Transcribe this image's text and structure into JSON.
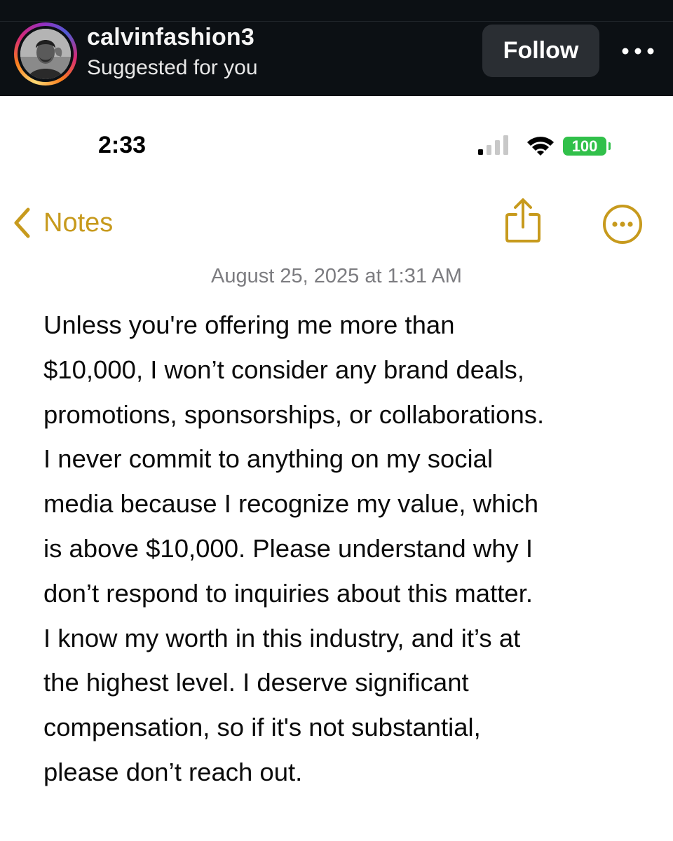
{
  "post_header": {
    "username": "calvinfashion3",
    "subtitle": "Suggested for you",
    "follow_label": "Follow",
    "more_icon": "ellipsis-icon"
  },
  "status_bar": {
    "time": "2:33",
    "battery": "100"
  },
  "nav": {
    "back_label": "Notes"
  },
  "note": {
    "date": "August 25, 2025 at 1:31 AM",
    "lines": [
      "Unless you're offering me more than",
      "$10,000, I won’t consider any brand deals,",
      "promotions, sponsorships, or collaborations.",
      "I never commit to anything on my social",
      "media because I recognize my value, which",
      "is above $10,000. Please understand why I",
      "don’t respond to inquiries about this matter.",
      "I know my worth in this industry, and it’s at",
      "the highest level. I deserve significant",
      "compensation, so if it's not substantial,",
      "please don’t reach out."
    ]
  },
  "colors": {
    "header_bg": "#0c1014",
    "accent_gold": "#c79a1d",
    "battery_green": "#31c04a",
    "date_gray": "#7c7c80"
  }
}
